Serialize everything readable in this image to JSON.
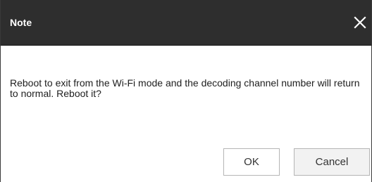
{
  "dialog": {
    "title": "Note",
    "close_icon": "close-icon",
    "message": "Reboot to exit from the Wi-Fi mode and the decoding channel number will return to normal. Reboot it?",
    "ok_label": "OK",
    "cancel_label": "Cancel"
  },
  "colors": {
    "titlebar_bg": "#2e2e2e",
    "title_text": "#ffffff",
    "body_bg": "#ffffff",
    "button_border": "#b5b5b5",
    "cancel_bg": "#f2f2f2"
  }
}
